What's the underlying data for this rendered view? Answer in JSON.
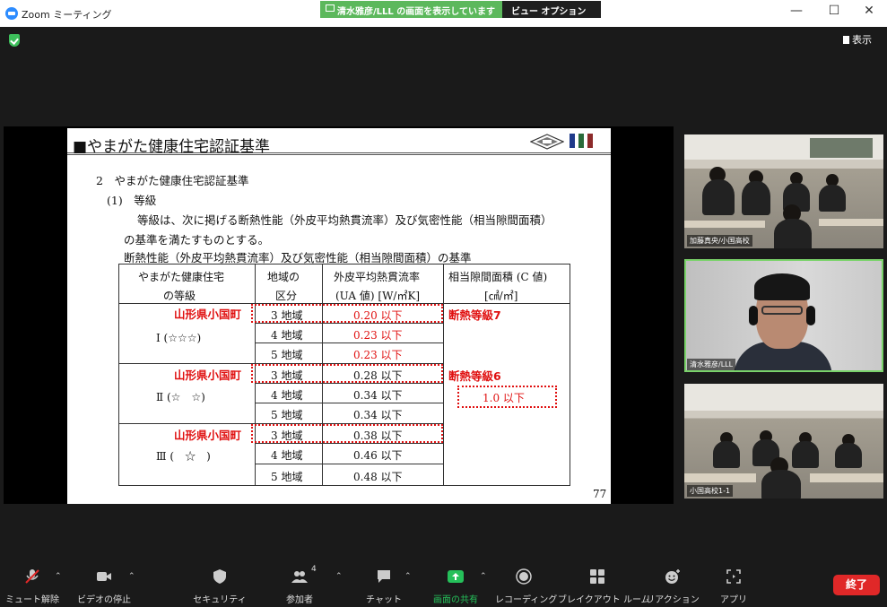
{
  "window": {
    "title": "Zoom ミーティング",
    "share_banner": "清水雅彦/LLL の画面を表示しています",
    "view_options": "ビュー オプション ⌄",
    "minimize": "—",
    "maximize": "☐",
    "close": "✕"
  },
  "meeting": {
    "view_label": "表示"
  },
  "slide": {
    "title": "■やまがた健康住宅認証基準",
    "line1": "2　やまがた健康住宅認証基準",
    "line2": "(1)　等級",
    "line3": "等級は、次に掲げる断熱性能（外皮平均熱貫流率）及び気密性能（相当隙間面積）",
    "line4": "の基準を満たすものとする。",
    "table_caption": "断熱性能（外皮平均熱貫流率）及び気密性能（相当隙間面積）の基準",
    "page_number": "77",
    "table": {
      "header": {
        "col1_l1": "やまがた健康住宅",
        "col1_l2": "の等級",
        "col2_l1": "地域の",
        "col2_l2": "区分",
        "col3_l1": "外皮平均熱貫流率",
        "col3_l2": "(UA 値) [W/㎡K]",
        "col4_l1": "相当隙間面積 (C 値)",
        "col4_l2": "[㎠/㎡]"
      },
      "grades": [
        {
          "grade": "Ⅰ (☆☆☆)",
          "town_label": "山形県小国町",
          "rows": [
            {
              "region": "3 地域",
              "ua": "0.20 以下"
            },
            {
              "region": "4 地域",
              "ua": "0.23 以下"
            },
            {
              "region": "5 地域",
              "ua": "0.23 以下"
            }
          ],
          "note": "断熱等級7"
        },
        {
          "grade": "Ⅱ (☆　☆)",
          "town_label": "山形県小国町",
          "rows": [
            {
              "region": "3 地域",
              "ua": "0.28 以下"
            },
            {
              "region": "4 地域",
              "ua": "0.34 以下"
            },
            {
              "region": "5 地域",
              "ua": "0.34 以下"
            }
          ],
          "note": "断熱等級6",
          "c_value": "1.0 以下"
        },
        {
          "grade": "Ⅲ (　☆　)",
          "town_label": "山形県小国町",
          "rows": [
            {
              "region": "3 地域",
              "ua": "0.38 以下"
            },
            {
              "region": "4 地域",
              "ua": "0.46 以下"
            },
            {
              "region": "5 地域",
              "ua": "0.48 以下"
            }
          ]
        }
      ]
    }
  },
  "participants": [
    {
      "name": "加藤真央/小国高校"
    },
    {
      "name": "清水雅彦/LLL"
    },
    {
      "name": "小国高校1-1"
    }
  ],
  "toolbar": {
    "mute": "ミュート解除",
    "video": "ビデオの停止",
    "security": "セキュリティ",
    "participants": "参加者",
    "participants_count": "4",
    "chat": "チャット",
    "share": "画面の共有",
    "record": "レコーディング",
    "breakout": "ブレイクアウト ルーム",
    "reactions": "リアクション",
    "apps": "アプリ",
    "end": "終了"
  },
  "colors": {
    "accent_green": "#5cb85c",
    "end_red": "#e02828",
    "annotation_red": "#e01010",
    "share_icon_green": "#25c05a"
  }
}
